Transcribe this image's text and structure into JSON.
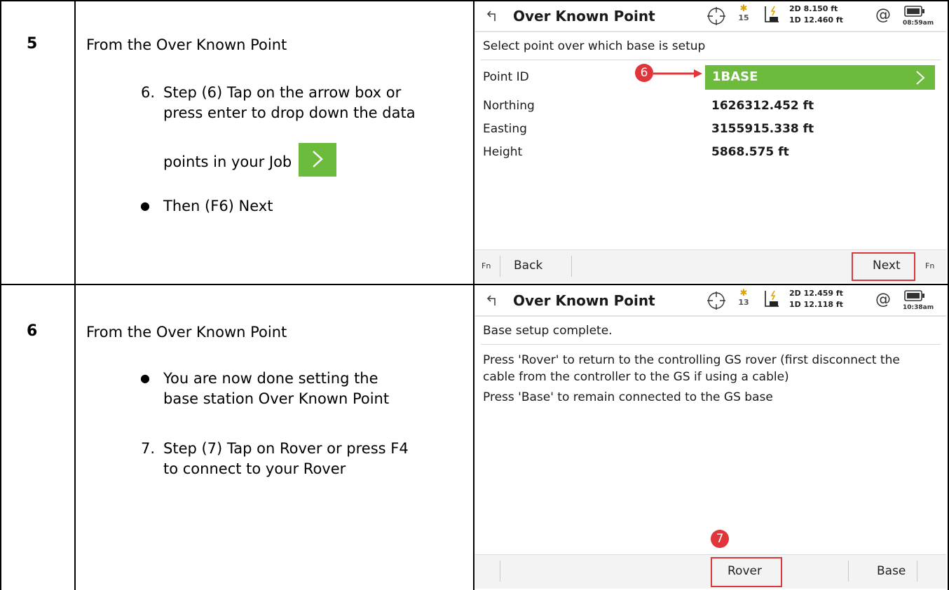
{
  "rows": [
    {
      "step": "5",
      "heading": "From the Over Known Point",
      "item1_num": "6.",
      "item1_line1": "Step (6) Tap on the arrow box or",
      "item1_line2": "press enter to drop down the data",
      "item1_line3": "points in your Job",
      "bullet1": "Then (F6) Next"
    },
    {
      "step": "6",
      "heading": "From the Over Known Point",
      "bullet1_line1": "You are now done setting the",
      "bullet1_line2": "base station Over Known Point",
      "item1_num": "7.",
      "item1_line1": "Step (7) Tap on Rover or press F4",
      "item1_line2": "to connect to your Rover"
    }
  ],
  "screen1": {
    "title": "Over Known Point",
    "satellites": "15",
    "precision_2d": "2D 8.150 ft",
    "precision_1d": "1D 12.460 ft",
    "time": "08:59am",
    "instruction": "Select point over which base is setup",
    "point_id_label": "Point ID",
    "point_id_value": "1BASE",
    "northing_label": "Northing",
    "northing_value": "1626312.452 ft",
    "easting_label": "Easting",
    "easting_value": "3155915.338 ft",
    "height_label": "Height",
    "height_value": "5868.575 ft",
    "callout": "6",
    "fn_left": "Fn",
    "fn_right": "Fn",
    "back_label": "Back",
    "next_label": "Next",
    "accent_color": "#6cbb3c"
  },
  "screen2": {
    "title": "Over Known Point",
    "satellites": "13",
    "precision_2d": "2D 12.459 ft",
    "precision_1d": "1D 12.118 ft",
    "time": "10:38am",
    "line1": "Base setup complete.",
    "line2a": "Press 'Rover' to return to the controlling GS rover (first disconnect the",
    "line2b": "cable from the controller to the GS if using a cable)",
    "line3": "Press 'Base' to remain connected to the GS base",
    "callout": "7",
    "rover_label": "Rover",
    "base_label": "Base"
  },
  "colors": {
    "callout": "#e0353b",
    "highlight_box": "#d83a3a",
    "green": "#6cbb3c"
  }
}
